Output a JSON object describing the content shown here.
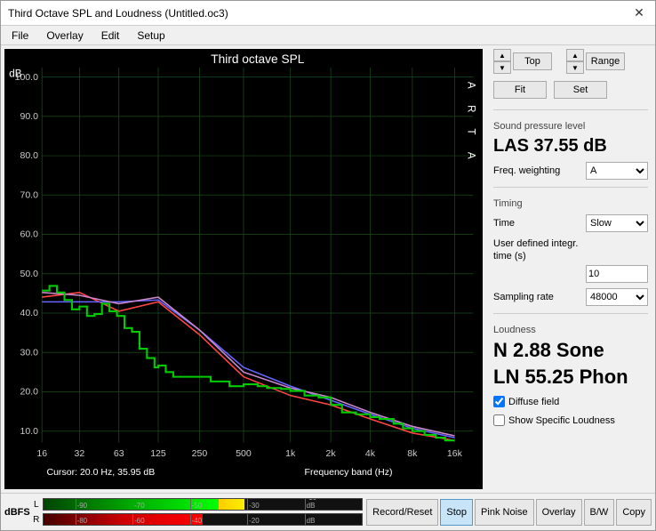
{
  "window": {
    "title": "Third Octave SPL and Loudness (Untitled.oc3)"
  },
  "menu": {
    "items": [
      "File",
      "Overlay",
      "Edit",
      "Setup"
    ]
  },
  "chart": {
    "title": "Third octave SPL",
    "db_label": "dB",
    "arta_label": "ARTA",
    "y_ticks": [
      "100.0",
      "90.0",
      "80.0",
      "70.0",
      "60.0",
      "50.0",
      "40.0",
      "30.0",
      "20.0",
      "10.0"
    ],
    "x_ticks": [
      "16",
      "32",
      "63",
      "125",
      "250",
      "500",
      "1k",
      "2k",
      "4k",
      "8k",
      "16k"
    ],
    "cursor_info": "Cursor:  20.0 Hz, 35.95 dB",
    "freq_band_label": "Frequency band (Hz)"
  },
  "controls": {
    "top_label": "Top",
    "range_label": "Range",
    "fit_label": "Fit",
    "set_label": "Set"
  },
  "spl": {
    "section_label": "Sound pressure level",
    "value": "LAS 37.55 dB",
    "freq_weighting_label": "Freq. weighting",
    "freq_weighting_value": "A"
  },
  "timing": {
    "section_label": "Timing",
    "time_label": "Time",
    "time_value": "Slow",
    "user_integ_label": "User defined integr. time (s)",
    "user_integ_value": "10",
    "sampling_rate_label": "Sampling rate",
    "sampling_rate_value": "48000"
  },
  "loudness": {
    "section_label": "Loudness",
    "n_value": "N 2.88 Sone",
    "ln_value": "LN 55.25 Phon",
    "diffuse_field_label": "Diffuse field",
    "diffuse_field_checked": true,
    "show_specific_label": "Show Specific Loudness",
    "show_specific_checked": false
  },
  "dbfs": {
    "label": "dBFS",
    "ticks_l": [
      "-90",
      "-70",
      "-50",
      "-30",
      "-10 dB"
    ],
    "ticks_r": [
      "-80",
      "-60",
      "-40",
      "-20",
      "dB"
    ]
  },
  "buttons": {
    "record_reset": "Record/Reset",
    "stop": "Stop",
    "pink_noise": "Pink Noise",
    "overlay": "Overlay",
    "bw": "B/W",
    "copy": "Copy"
  }
}
